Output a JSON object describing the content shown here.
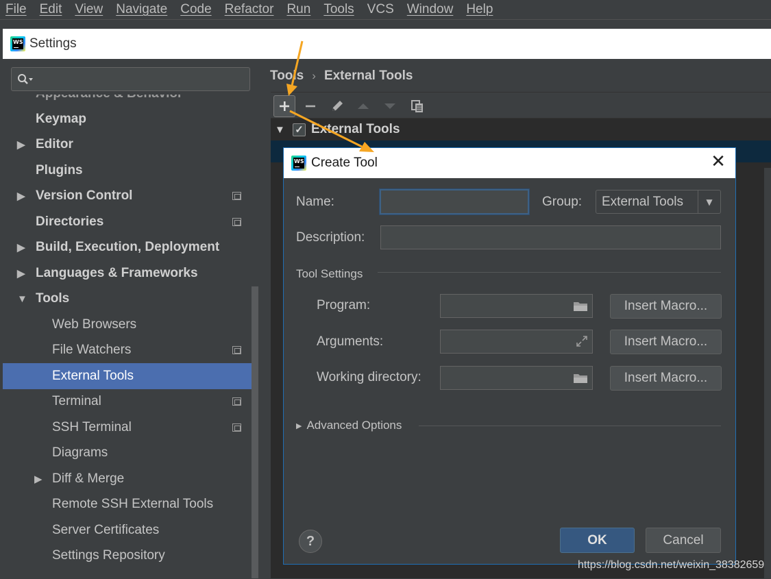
{
  "menu": [
    "File",
    "Edit",
    "View",
    "Navigate",
    "Code",
    "Refactor",
    "Run",
    "Tools",
    "VCS",
    "Window",
    "Help"
  ],
  "settings_window": {
    "title": "Settings",
    "app_logo_text": "WS"
  },
  "search": {
    "placeholder": "",
    "icon": "search-icon"
  },
  "tree": {
    "cut_item": "Appearance & Behavior",
    "items": [
      {
        "label": "Keymap"
      },
      {
        "label": "Editor"
      },
      {
        "label": "Plugins"
      },
      {
        "label": "Version Control"
      },
      {
        "label": "Directories"
      },
      {
        "label": "Build, Execution, Deployment"
      },
      {
        "label": "Languages & Frameworks"
      },
      {
        "label": "Tools"
      },
      {
        "label": "Web Browsers"
      },
      {
        "label": "File Watchers"
      },
      {
        "label": "External Tools"
      },
      {
        "label": "Terminal"
      },
      {
        "label": "SSH Terminal"
      },
      {
        "label": "Diagrams"
      },
      {
        "label": "Diff & Merge"
      },
      {
        "label": "Remote SSH External Tools"
      },
      {
        "label": "Server Certificates"
      },
      {
        "label": "Settings Repository"
      }
    ]
  },
  "breadcrumb": {
    "parent": "Tools",
    "current": "External Tools"
  },
  "external_tools_group": {
    "label": "External Tools",
    "checked": true
  },
  "dialog": {
    "title": "Create Tool",
    "name_label": "Name:",
    "name_value": "",
    "group_label": "Group:",
    "group_value": "External Tools",
    "description_label": "Description:",
    "description_value": "",
    "tool_settings_label": "Tool Settings",
    "program_label": "Program:",
    "arguments_label": "Arguments:",
    "working_directory_label": "Working directory:",
    "insert_macro_label": "Insert Macro...",
    "advanced_options_label": "Advanced Options",
    "help_label": "?",
    "ok_label": "OK",
    "cancel_label": "Cancel"
  },
  "watermark": "https://blog.csdn.net/weixin_38382659",
  "colors": {
    "background": "#3c3f41",
    "selection": "#4b6eaf",
    "ok_button": "#365880",
    "annotation_arrow": "#f5a623"
  }
}
